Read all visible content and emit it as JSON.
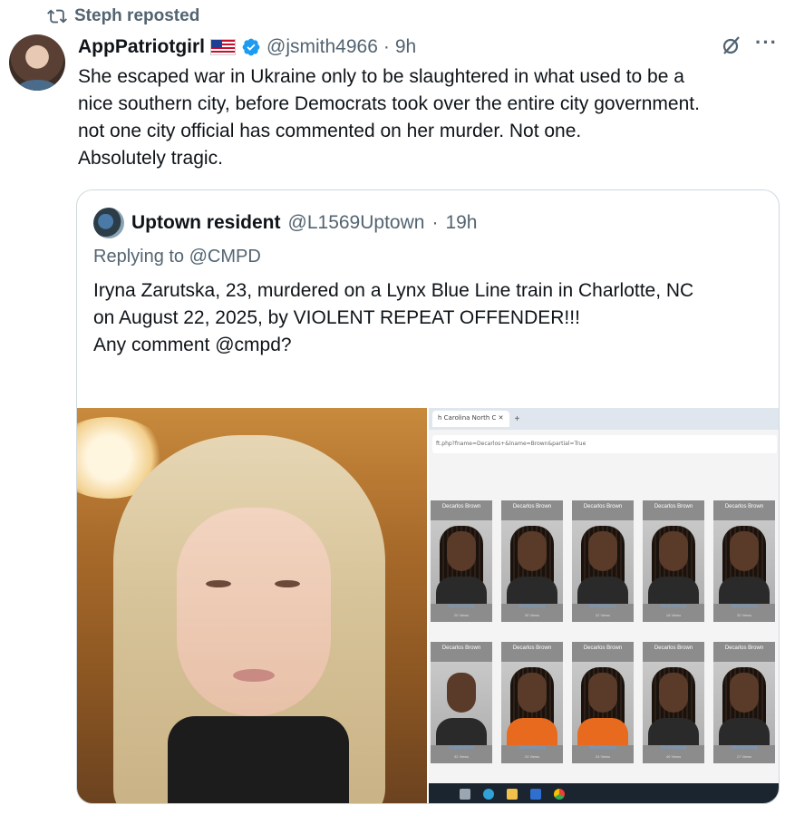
{
  "repost": {
    "label": "Steph reposted",
    "icon": "repost-icon"
  },
  "post": {
    "display_name": "AppPatriotgirl",
    "flag": "us-flag-emoji",
    "verified_icon": "verified-badge-icon",
    "handle": "@jsmith4966",
    "dot": "·",
    "time": "9h",
    "text_lines": [
      "She escaped war in Ukraine only to be slaughtered in what used to be a",
      "nice southern city, before Democrats took over the entire city government.",
      "not one city official has commented on her murder. Not one.",
      "Absolutely tragic."
    ],
    "more_label": "···"
  },
  "quote": {
    "display_name": "Uptown resident",
    "handle": "@L1569Uptown",
    "dot": "·",
    "time": "19h",
    "reply_prefix": "Replying to",
    "reply_to": "@CMPD",
    "text_lines": [
      "Iryna Zarutska, 23, murdered on a Lynx Blue Line train in Charlotte, NC",
      "on August 22, 2025, by VIOLENT REPEAT OFFENDER!!!",
      "",
      "Any comment @cmpd?"
    ]
  },
  "media_screenshot": {
    "tab_title": "h Carolina North C",
    "tab_close": "✕",
    "tab_plus": "+",
    "url": "ft.php?fname=Decarlos+&lname=Brown&partial=True",
    "mugshots": [
      {
        "name": "Decarlos Brown",
        "county": "Mecklenburg",
        "views": "20 Views",
        "style": "locs",
        "shirt": "dark"
      },
      {
        "name": "Decarlos Brown",
        "county": "Mecklenburg",
        "views": "30 Views",
        "style": "locs",
        "shirt": "dark"
      },
      {
        "name": "Decarlos Brown",
        "county": "Mecklenburg",
        "views": "22 Views",
        "style": "locs",
        "shirt": "dark"
      },
      {
        "name": "Decarlos Brown",
        "county": "Mecklenburg",
        "views": "18 Views",
        "style": "locs",
        "shirt": "dark"
      },
      {
        "name": "Decarlos Brown",
        "county": "Mecklenburg",
        "views": "32 Views",
        "style": "locs",
        "shirt": "dark"
      },
      {
        "name": "Decarlos Brown",
        "county": "Cumberland",
        "views": "32 Views",
        "style": "short",
        "shirt": "dark"
      },
      {
        "name": "Decarlos Brown",
        "county": "Mecklenburg",
        "views": "24 Views",
        "style": "locs",
        "shirt": "orange"
      },
      {
        "name": "Decarlos Brown",
        "county": "Mecklenburg",
        "views": "24 Views",
        "style": "locs",
        "shirt": "orange"
      },
      {
        "name": "Decarlos Brown",
        "county": "Mecklenburg",
        "views": "40 Views",
        "style": "locs",
        "shirt": "dark"
      },
      {
        "name": "Decarlos Brown",
        "county": "Mecklenburg",
        "views": "27 Views",
        "style": "locs",
        "shirt": "dark"
      }
    ]
  },
  "colors": {
    "text": "#0f1419",
    "muted": "#536471",
    "verified": "#1d9bf0",
    "border": "#cfd9de"
  }
}
